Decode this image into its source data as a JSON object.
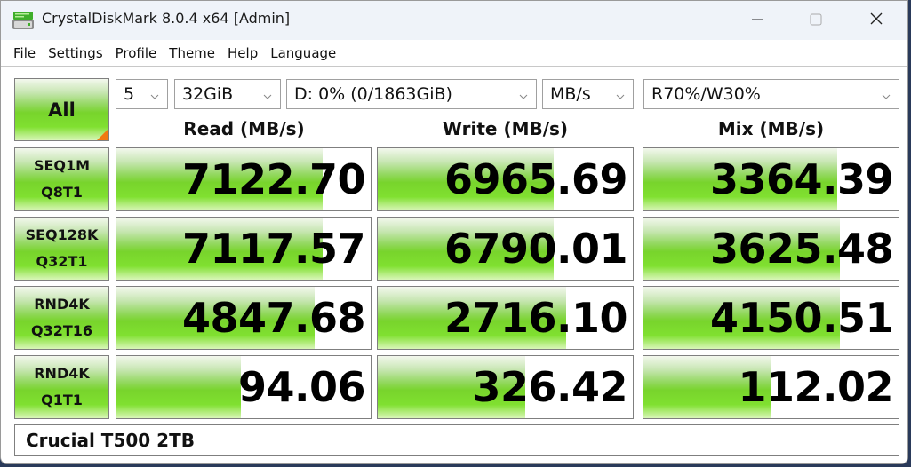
{
  "window": {
    "title": "CrystalDiskMark 8.0.4 x64 [Admin]",
    "app_icon": "disk-drive-icon",
    "controls": {
      "minimize": "minimize-icon",
      "maximize": "maximize-icon",
      "close": "close-icon"
    }
  },
  "menu": [
    "File",
    "Settings",
    "Profile",
    "Theme",
    "Help",
    "Language"
  ],
  "toolbar": {
    "all_label": "All",
    "test_count": "5",
    "test_size": "32GiB",
    "drive": "D: 0% (0/1863GiB)",
    "unit": "MB/s",
    "mix_ratio": "R70%/W30%"
  },
  "headers": {
    "read": "Read (MB/s)",
    "write": "Write (MB/s)",
    "mix": "Mix (MB/s)"
  },
  "colors": {
    "bar_green": "#78d42c",
    "corner_orange": "#f07a10"
  },
  "tests": [
    {
      "line1": "SEQ1M",
      "line2": "Q8T1",
      "read": "7122.70",
      "write": "6965.69",
      "mix": "3364.39",
      "read_fill": 0.81,
      "write_fill": 0.69,
      "mix_fill": 0.76
    },
    {
      "line1": "SEQ128K",
      "line2": "Q32T1",
      "read": "7117.57",
      "write": "6790.01",
      "mix": "3625.48",
      "read_fill": 0.81,
      "write_fill": 0.69,
      "mix_fill": 0.77
    },
    {
      "line1": "RND4K",
      "line2": "Q32T16",
      "read": "4847.68",
      "write": "2716.10",
      "mix": "4150.51",
      "read_fill": 0.78,
      "write_fill": 0.74,
      "mix_fill": 0.77
    },
    {
      "line1": "RND4K",
      "line2": "Q1T1",
      "read": "94.06",
      "write": "326.42",
      "mix": "112.02",
      "read_fill": 0.49,
      "write_fill": 0.58,
      "mix_fill": 0.5
    }
  ],
  "comment": "Crucial T500 2TB"
}
